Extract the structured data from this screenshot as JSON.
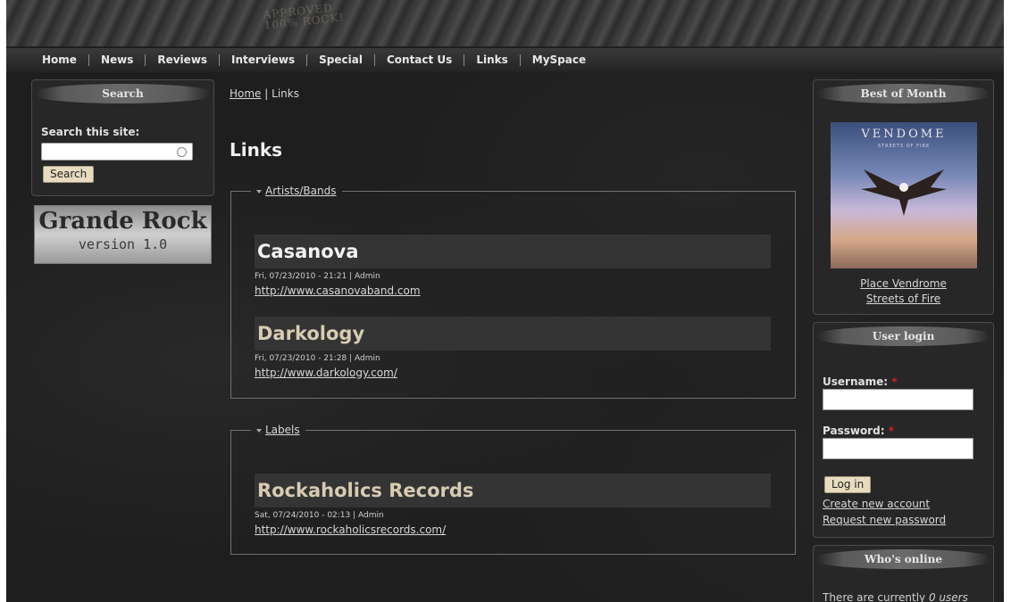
{
  "header": {
    "stamp_line1": "APPROVED",
    "stamp_line2": "100% ROCK!"
  },
  "nav": [
    "Home",
    "News",
    "Reviews",
    "Interviews",
    "Special",
    "Contact Us",
    "Links",
    "MySpace"
  ],
  "search_block": {
    "title": "Search",
    "label": "Search this site:",
    "input_value": "",
    "button_label": "Search"
  },
  "logo": {
    "line1": "Grande Rock",
    "line2": "version 1.0"
  },
  "breadcrumb": {
    "home": "Home",
    "separator": "|",
    "current": "Links"
  },
  "page_title": "Links",
  "groups": [
    {
      "legend": "Artists/Bands",
      "entries": [
        {
          "title": "Casanova",
          "meta": "Fri, 07/23/2010 - 21:21 |  Admin",
          "url": "http://www.casanovaband.com"
        },
        {
          "title": "Darkology",
          "meta": "Fri, 07/23/2010 - 21:28 |  Admin",
          "url": "http://www.darkology.com/"
        }
      ]
    },
    {
      "legend": "Labels",
      "entries": [
        {
          "title": "Rockaholics Records",
          "meta": "Sat, 07/24/2010 - 02:13 |  Admin",
          "url": "http://www.rockaholicsrecords.com/"
        }
      ]
    }
  ],
  "best_of_month": {
    "title": "Best of Month",
    "cover_band": "VENDOME",
    "cover_subtitle": "STREETS OF FIRE",
    "link_line1": "Place Vendrome",
    "link_line2": "Streets of Fire"
  },
  "user_login": {
    "title": "User login",
    "username_label": "Username:",
    "password_label": "Password:",
    "required_mark": "*",
    "login_button": "Log in",
    "create_account": "Create new account",
    "request_password": "Request new password"
  },
  "whos_online": {
    "title": "Who's online",
    "text_prefix": "There are currently ",
    "text_italic": "0 users"
  },
  "colors": {
    "background": "#1e1e1e",
    "panel": "#272727",
    "required": "#cc2222",
    "button": "#e8dcc0"
  }
}
